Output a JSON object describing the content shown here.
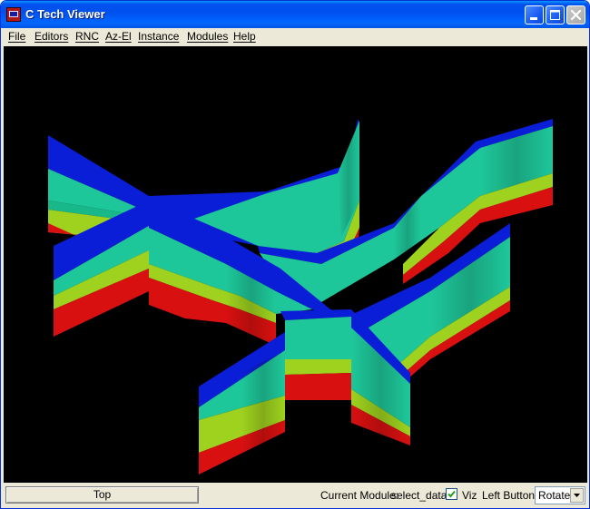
{
  "window": {
    "title": "C Tech Viewer",
    "icons": {
      "app": "c-tech-app-icon",
      "minimize": "minimize-icon",
      "maximize": "maximize-icon",
      "close": "close-icon"
    }
  },
  "menu": {
    "items": [
      "File",
      "Editors",
      "RNC",
      "Az-El",
      "Instance",
      "Modules",
      "Help"
    ]
  },
  "viewport": {
    "background": "#000000",
    "layer_colors": [
      "#0a1ed8",
      "#1ec79a",
      "#9ed21e",
      "#d81010"
    ]
  },
  "status": {
    "top_button_label": "Top",
    "current_module_label": "Current Module:",
    "current_module_value": "select_data",
    "viz_label": "Viz",
    "viz_checked": true,
    "left_button_label": "Left Button",
    "left_button_value": "Rotate"
  }
}
